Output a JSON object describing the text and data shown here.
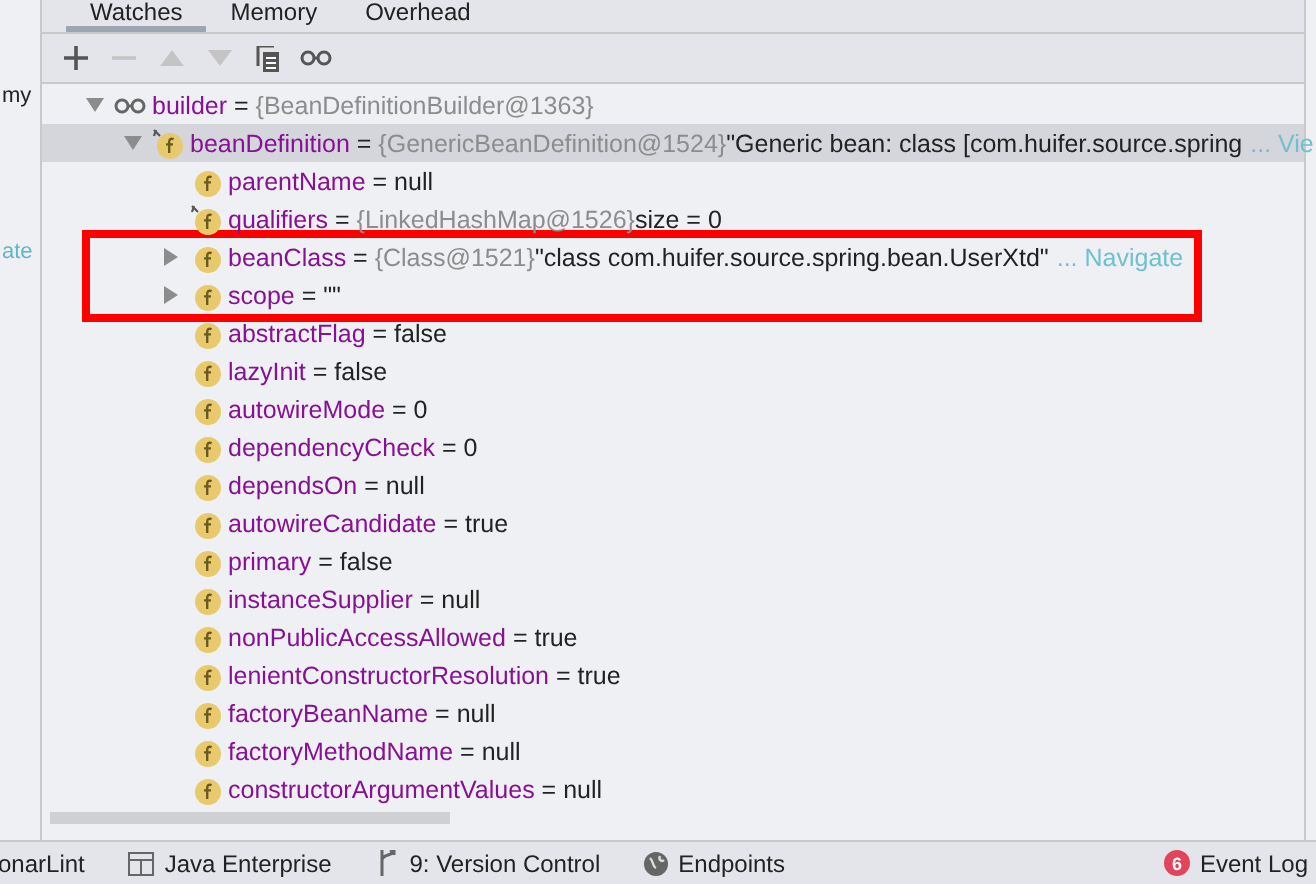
{
  "left_panel": {
    "texts": [
      "my",
      "ate"
    ]
  },
  "tabs": [
    {
      "label": "Watches",
      "selected": true
    },
    {
      "label": "Memory",
      "selected": false
    },
    {
      "label": "Overhead",
      "selected": false
    }
  ],
  "toolbar": [
    {
      "kind": "add",
      "disabled": false
    },
    {
      "kind": "remove",
      "disabled": true
    },
    {
      "kind": "up",
      "disabled": true
    },
    {
      "kind": "down",
      "disabled": true
    },
    {
      "kind": "copy",
      "disabled": false
    },
    {
      "kind": "watch",
      "disabled": false
    }
  ],
  "tree": [
    {
      "kind": "watch",
      "name": "builder",
      "op": "=",
      "ref": "{BeanDefinitionBuilder@1363}",
      "expanded": true,
      "selected": false,
      "children": [
        {
          "kind": "field-marked",
          "name": "beanDefinition",
          "op": "=",
          "ref": "{GenericBeanDefinition@1524}",
          "value": "\"Generic bean: class [com.huifer.source.spring",
          "link": "... Vie",
          "expanded": true,
          "selected": true,
          "children": [
            {
              "kind": "field",
              "name": "parentName",
              "op": "=",
              "value": "null",
              "selected": false,
              "highlighted": false
            },
            {
              "kind": "field-marked",
              "name": "qualifiers",
              "op": "=",
              "ref": "{LinkedHashMap@1526}",
              "extra": "size = 0",
              "selected": false,
              "highlighted": false
            },
            {
              "kind": "field",
              "name": "beanClass",
              "op": "=",
              "ref": "{Class@1521}",
              "value": "\"class com.huifer.source.spring.bean.UserXtd\"",
              "link": "... Navigate",
              "expanded": false,
              "selected": false,
              "highlighted": true
            },
            {
              "kind": "field",
              "name": "scope",
              "op": "=",
              "value": "\"\"",
              "expanded": false,
              "selected": false,
              "highlighted": true
            },
            {
              "kind": "field",
              "name": "abstractFlag",
              "op": "=",
              "value": "false",
              "selected": false,
              "highlighted": false
            },
            {
              "kind": "field",
              "name": "lazyInit",
              "op": "=",
              "value": "false",
              "selected": false,
              "highlighted": false
            },
            {
              "kind": "field",
              "name": "autowireMode",
              "op": "=",
              "value": "0",
              "selected": false,
              "highlighted": false
            },
            {
              "kind": "field",
              "name": "dependencyCheck",
              "op": "=",
              "value": "0",
              "selected": false,
              "highlighted": false
            },
            {
              "kind": "field",
              "name": "dependsOn",
              "op": "=",
              "value": "null",
              "selected": false,
              "highlighted": false
            },
            {
              "kind": "field",
              "name": "autowireCandidate",
              "op": "=",
              "value": "true",
              "selected": false,
              "highlighted": false
            },
            {
              "kind": "field",
              "name": "primary",
              "op": "=",
              "value": "false",
              "selected": false,
              "highlighted": false
            },
            {
              "kind": "field",
              "name": "instanceSupplier",
              "op": "=",
              "value": "null",
              "selected": false,
              "highlighted": false
            },
            {
              "kind": "field",
              "name": "nonPublicAccessAllowed",
              "op": "=",
              "value": "true",
              "selected": false,
              "highlighted": false
            },
            {
              "kind": "field",
              "name": "lenientConstructorResolution",
              "op": "=",
              "value": "true",
              "selected": false,
              "highlighted": false
            },
            {
              "kind": "field",
              "name": "factoryBeanName",
              "op": "=",
              "value": "null",
              "selected": false,
              "highlighted": false
            },
            {
              "kind": "field",
              "name": "factoryMethodName",
              "op": "=",
              "value": "null",
              "selected": false,
              "highlighted": false
            },
            {
              "kind": "field",
              "name": "constructorArgumentValues",
              "op": "=",
              "value": "null",
              "selected": false,
              "highlighted": false
            }
          ]
        }
      ]
    }
  ],
  "status_bar": [
    {
      "kind": "plain",
      "label": "onarLint"
    },
    {
      "kind": "enterprise",
      "label": "Java Enterprise"
    },
    {
      "kind": "vcs",
      "label": "9: Version Control"
    },
    {
      "kind": "globe",
      "label": "Endpoints"
    },
    {
      "kind": "events",
      "badge": "6",
      "label": "Event Log"
    }
  ]
}
